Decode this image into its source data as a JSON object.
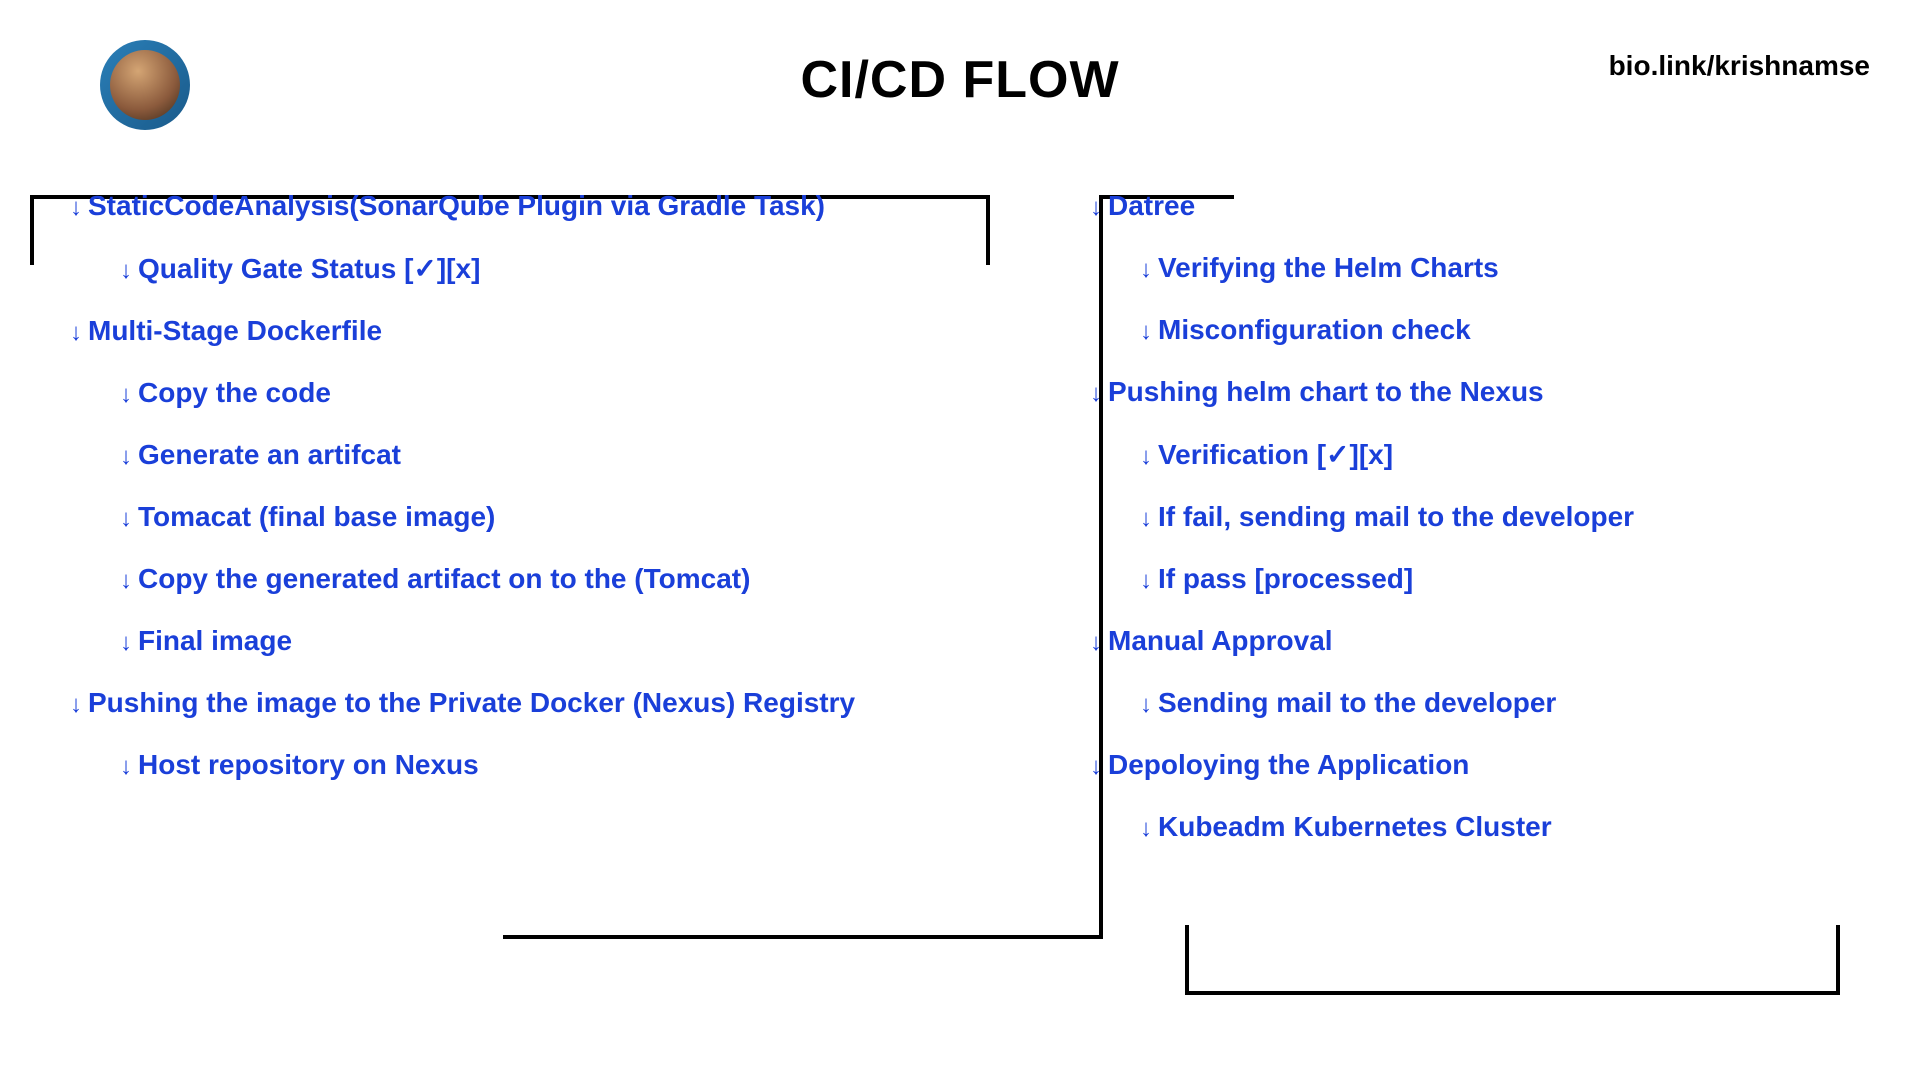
{
  "title": "CI/CD FLOW",
  "bioLink": "bio.link/krishnamse",
  "leftColumn": {
    "items": [
      {
        "type": "main",
        "text": "StaticCodeAnalysis(SonarQube Plugin via Gradle Task)"
      },
      {
        "type": "sub",
        "text": "Quality Gate Status [✓][x]"
      },
      {
        "type": "main",
        "text": "Multi-Stage Dockerfile"
      },
      {
        "type": "sub",
        "text": "Copy the code"
      },
      {
        "type": "sub",
        "text": "Generate an artifcat"
      },
      {
        "type": "sub",
        "text": "Tomacat (final base image)"
      },
      {
        "type": "sub",
        "text": "Copy the generated artifact on to the (Tomcat)"
      },
      {
        "type": "sub",
        "text": "Final image"
      },
      {
        "type": "main",
        "text": "Pushing the image to the Private Docker (Nexus) Registry"
      },
      {
        "type": "sub",
        "text": "Host repository on Nexus"
      }
    ]
  },
  "rightColumn": {
    "items": [
      {
        "type": "main",
        "text": "Datree"
      },
      {
        "type": "sub",
        "text": "Verifying the Helm Charts"
      },
      {
        "type": "sub",
        "text": "Misconfiguration check"
      },
      {
        "type": "main",
        "text": "Pushing helm chart to the Nexus"
      },
      {
        "type": "sub",
        "text": "Verification [✓][x]"
      },
      {
        "type": "sub",
        "text": "If fail, sending mail to the developer"
      },
      {
        "type": "sub",
        "text": "If pass [processed]"
      },
      {
        "type": "main",
        "text": "Manual Approval"
      },
      {
        "type": "sub",
        "text": "Sending mail to the developer"
      },
      {
        "type": "main",
        "text": "Depoloying the Application"
      },
      {
        "type": "sub",
        "text": "Kubeadm Kubernetes Cluster"
      }
    ]
  }
}
